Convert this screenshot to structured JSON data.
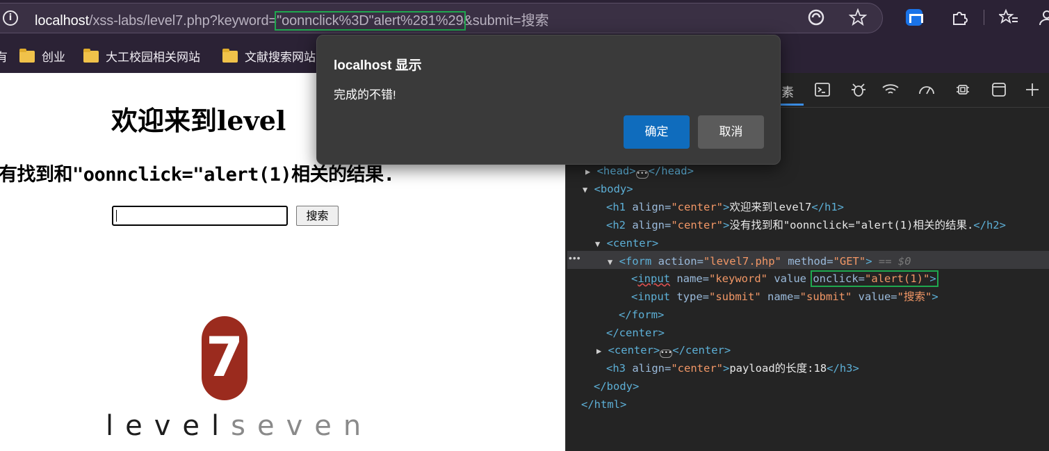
{
  "browser": {
    "url_host": "localhost",
    "url_path": "/xss-labs/level7.php?keyword=",
    "url_highlight": "\"oonnclick%3D\"alert%281%29",
    "url_rest": "&submit=搜索",
    "bookmarks": [
      {
        "label": "创业"
      },
      {
        "label": "大工校园相关网站"
      },
      {
        "label": "文献搜索网站"
      }
    ],
    "bookmark_partial": "有"
  },
  "page": {
    "h1": "欢迎来到level",
    "h2": "有找到和\"oonnclick=\"alert(1)相关的结果.",
    "search_button": "搜索",
    "logo_digit": "7",
    "logo_text_a": "level",
    "logo_text_b": "seven"
  },
  "devtools": {
    "active_tab_partial": "素",
    "lines": {
      "head_open": "<head>",
      "head_close": "</head>",
      "body_open": "<body>",
      "h1_tag": "<h1 ",
      "h1_attr": "align=",
      "h1_val": "\"center\"",
      "h1_close_bracket": ">",
      "h1_text": "欢迎来到level7",
      "h1_end": "</h1>",
      "h2_tag": "<h2 ",
      "h2_attr": "align=",
      "h2_val": "\"center\"",
      "h2_close_bracket": ">",
      "h2_text": "没有找到和\"oonnclick=\"alert(1)相关的结果.",
      "h2_end": "</h2>",
      "center_open": "<center>",
      "form_tag": "<form ",
      "form_action_attr": "action=",
      "form_action_val": "\"level7.php\"",
      "form_method_attr": " method=",
      "form_method_val": "\"GET\"",
      "form_close_bracket": ">",
      "form_selected": " == $0",
      "input1_tag": "input",
      "input1_lt": "<",
      "input1_name_attr": " name=",
      "input1_name_val": "\"keyword\"",
      "input1_value_attr": " value ",
      "input1_onclick_attr": "onclick=",
      "input1_onclick_val": "\"alert(1)\"",
      "input1_end": ">",
      "input2_tag": "<input ",
      "input2_type_attr": "type=",
      "input2_type_val": "\"submit\"",
      "input2_name_attr": " name=",
      "input2_name_val": "\"submit\"",
      "input2_value_attr": " value=",
      "input2_value_val": "\"搜索\"",
      "input2_end": ">",
      "form_end": "</form>",
      "center_end": "</center>",
      "center2_open": "<center>",
      "center2_close": "</center>",
      "h3_tag": "<h3 ",
      "h3_attr": "align=",
      "h3_val": "\"center\"",
      "h3_close_bracket": ">",
      "h3_text": "payload的长度:18",
      "h3_end": "</h3>",
      "body_end": "</body>",
      "html_end": "</html>",
      "more": "•••"
    }
  },
  "dialog": {
    "title": "localhost 显示",
    "message": "完成的不错!",
    "ok": "确定",
    "cancel": "取消"
  },
  "colors": {
    "accent_blue": "#0f6cbd",
    "highlight_green": "#1fa84f",
    "logo_red": "#9b2b1e"
  }
}
